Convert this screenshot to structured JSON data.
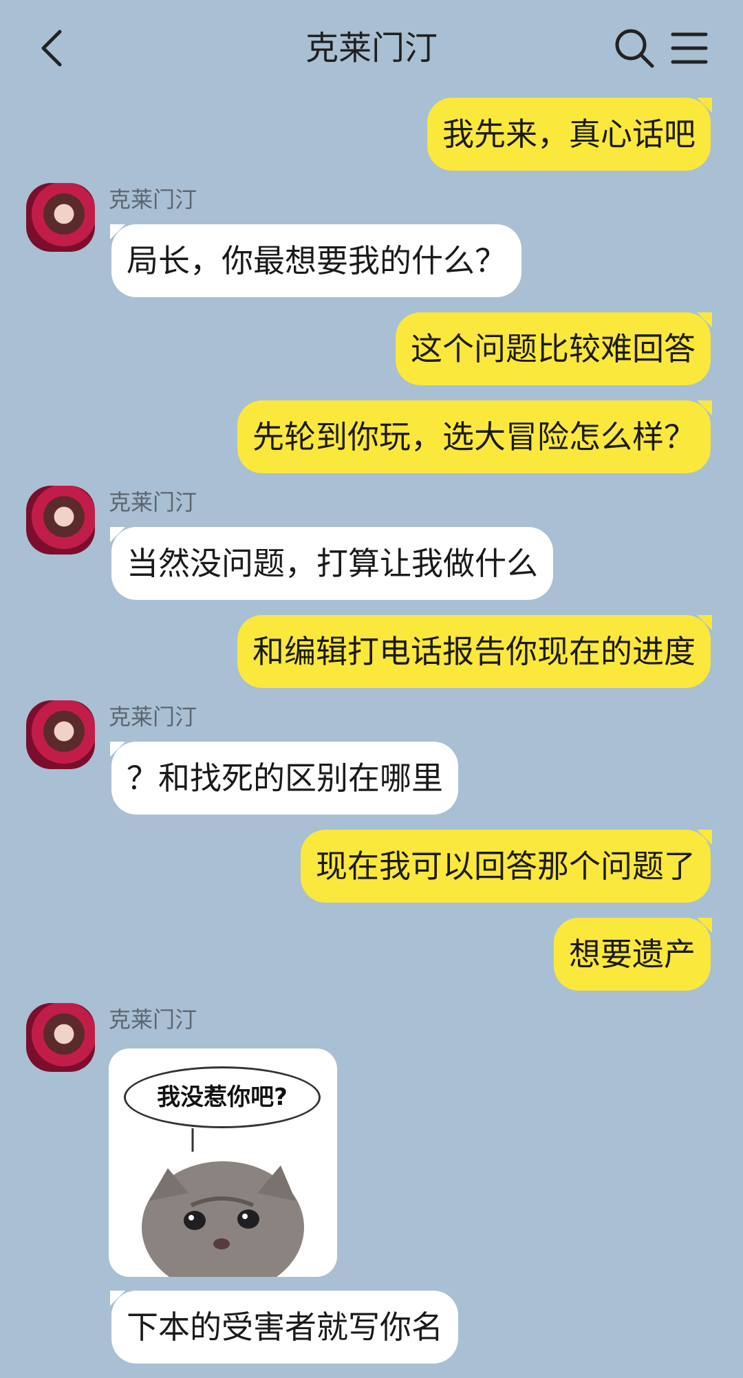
{
  "header": {
    "title": "克莱门汀",
    "back_icon": "chevron-left-icon",
    "search_icon": "search-icon",
    "menu_icon": "menu-icon"
  },
  "colors": {
    "background": "#a9bfd3",
    "my_bubble": "#fbe83c",
    "their_bubble": "#ffffff"
  },
  "messages": [
    {
      "from": "me",
      "text": "我先来，真心话吧"
    },
    {
      "from": "them",
      "sender": "克莱门汀",
      "text": "局长，你最想要我的什么？"
    },
    {
      "from": "me",
      "text": "这个问题比较难回答"
    },
    {
      "from": "me",
      "text": "先轮到你玩，选大冒险怎么样？"
    },
    {
      "from": "them",
      "sender": "克莱门汀",
      "text": "当然没问题，打算让我做什么"
    },
    {
      "from": "me",
      "text": "和编辑打电话报告你现在的进度"
    },
    {
      "from": "them",
      "sender": "克莱门汀",
      "text": "？和找死的区别在哪里"
    },
    {
      "from": "me",
      "text": "现在我可以回答那个问题了"
    },
    {
      "from": "me",
      "text": "想要遗产"
    },
    {
      "from": "them",
      "sender": "克莱门汀",
      "sticker_text": "我没惹你吧?"
    },
    {
      "from": "them",
      "text": "下本的受害者就写你名"
    }
  ]
}
